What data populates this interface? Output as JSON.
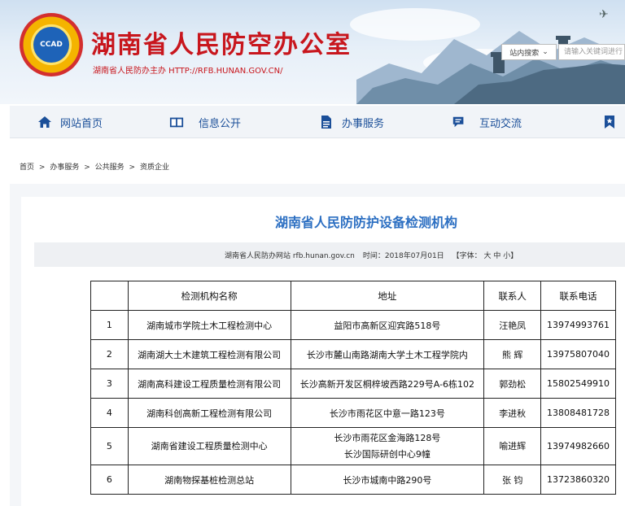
{
  "header": {
    "title": "湖南省人民防空办公室",
    "subtitle": "湖南省人民防办主办 HTTP://RFB.HUNAN.GOV.CN/",
    "logo_text": "CCAD",
    "search_scope": "站内搜索",
    "search_placeholder": "请输入关键词进行"
  },
  "nav": {
    "items": [
      {
        "label": "网站首页",
        "icon": "home-icon"
      },
      {
        "label": "信息公开",
        "icon": "book-icon"
      },
      {
        "label": "办事服务",
        "icon": "document-icon"
      },
      {
        "label": "互动交流",
        "icon": "chat-icon"
      },
      {
        "label": "",
        "icon": "bookmark-icon"
      }
    ]
  },
  "breadcrumb": [
    "首页",
    ">",
    "办事服务",
    ">",
    "公共服务",
    ">",
    "资质企业"
  ],
  "article": {
    "title": "湖南省人民防防护设备检测机构",
    "source": "湖南省人民防办网站 rfb.hunan.gov.cn",
    "time": "时间：2018年07月01日",
    "font_size": "【字体：  大 中 小】"
  },
  "table": {
    "headers": [
      "",
      "检测机构名称",
      "地址",
      "联系人",
      "联系电话"
    ],
    "rows": [
      {
        "idx": "1",
        "name": "湖南城市学院土木工程检测中心",
        "addr1": "益阳市高新区迎宾路518号",
        "addr2": "",
        "person": "汪艳凤",
        "phone": "13974993761"
      },
      {
        "idx": "2",
        "name": "湖南湖大土木建筑工程检测有限公司",
        "addr1": "长沙市麓山南路湖南大学土木工程学院内",
        "addr2": "",
        "person": "熊  辉",
        "phone": "13975807040"
      },
      {
        "idx": "3",
        "name": "湖南高科建设工程质量检测有限公司",
        "addr1": "长沙高新开发区桐梓坡西路229号A-6栋102",
        "addr2": "",
        "person": "郭劲松",
        "phone": "15802549910"
      },
      {
        "idx": "4",
        "name": "湖南科创高新工程检测有限公司",
        "addr1": "长沙市雨花区中意一路123号",
        "addr2": "",
        "person": "李进秋",
        "phone": "13808481728"
      },
      {
        "idx": "5",
        "name": "湖南省建设工程质量检测中心",
        "addr1": "长沙市雨花区金海路128号",
        "addr2": "长沙国际研创中心9幢",
        "person": "喻进辉",
        "phone": "13974982660"
      },
      {
        "idx": "6",
        "name": "湖南物探基桩检测总站",
        "addr1": "长沙市城南中路290号",
        "addr2": "",
        "person": "张  钧",
        "phone": "13723860320"
      }
    ]
  }
}
